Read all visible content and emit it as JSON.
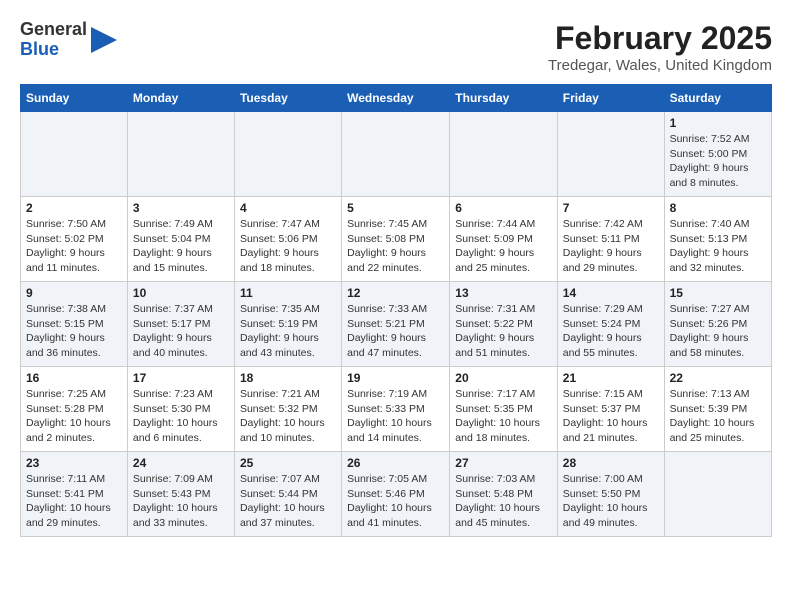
{
  "header": {
    "logo_general": "General",
    "logo_blue": "Blue",
    "month_year": "February 2025",
    "location": "Tredegar, Wales, United Kingdom"
  },
  "weekdays": [
    "Sunday",
    "Monday",
    "Tuesday",
    "Wednesday",
    "Thursday",
    "Friday",
    "Saturday"
  ],
  "weeks": [
    [
      {
        "day": "",
        "info": ""
      },
      {
        "day": "",
        "info": ""
      },
      {
        "day": "",
        "info": ""
      },
      {
        "day": "",
        "info": ""
      },
      {
        "day": "",
        "info": ""
      },
      {
        "day": "",
        "info": ""
      },
      {
        "day": "1",
        "info": "Sunrise: 7:52 AM\nSunset: 5:00 PM\nDaylight: 9 hours and 8 minutes."
      }
    ],
    [
      {
        "day": "2",
        "info": "Sunrise: 7:50 AM\nSunset: 5:02 PM\nDaylight: 9 hours and 11 minutes."
      },
      {
        "day": "3",
        "info": "Sunrise: 7:49 AM\nSunset: 5:04 PM\nDaylight: 9 hours and 15 minutes."
      },
      {
        "day": "4",
        "info": "Sunrise: 7:47 AM\nSunset: 5:06 PM\nDaylight: 9 hours and 18 minutes."
      },
      {
        "day": "5",
        "info": "Sunrise: 7:45 AM\nSunset: 5:08 PM\nDaylight: 9 hours and 22 minutes."
      },
      {
        "day": "6",
        "info": "Sunrise: 7:44 AM\nSunset: 5:09 PM\nDaylight: 9 hours and 25 minutes."
      },
      {
        "day": "7",
        "info": "Sunrise: 7:42 AM\nSunset: 5:11 PM\nDaylight: 9 hours and 29 minutes."
      },
      {
        "day": "8",
        "info": "Sunrise: 7:40 AM\nSunset: 5:13 PM\nDaylight: 9 hours and 32 minutes."
      }
    ],
    [
      {
        "day": "9",
        "info": "Sunrise: 7:38 AM\nSunset: 5:15 PM\nDaylight: 9 hours and 36 minutes."
      },
      {
        "day": "10",
        "info": "Sunrise: 7:37 AM\nSunset: 5:17 PM\nDaylight: 9 hours and 40 minutes."
      },
      {
        "day": "11",
        "info": "Sunrise: 7:35 AM\nSunset: 5:19 PM\nDaylight: 9 hours and 43 minutes."
      },
      {
        "day": "12",
        "info": "Sunrise: 7:33 AM\nSunset: 5:21 PM\nDaylight: 9 hours and 47 minutes."
      },
      {
        "day": "13",
        "info": "Sunrise: 7:31 AM\nSunset: 5:22 PM\nDaylight: 9 hours and 51 minutes."
      },
      {
        "day": "14",
        "info": "Sunrise: 7:29 AM\nSunset: 5:24 PM\nDaylight: 9 hours and 55 minutes."
      },
      {
        "day": "15",
        "info": "Sunrise: 7:27 AM\nSunset: 5:26 PM\nDaylight: 9 hours and 58 minutes."
      }
    ],
    [
      {
        "day": "16",
        "info": "Sunrise: 7:25 AM\nSunset: 5:28 PM\nDaylight: 10 hours and 2 minutes."
      },
      {
        "day": "17",
        "info": "Sunrise: 7:23 AM\nSunset: 5:30 PM\nDaylight: 10 hours and 6 minutes."
      },
      {
        "day": "18",
        "info": "Sunrise: 7:21 AM\nSunset: 5:32 PM\nDaylight: 10 hours and 10 minutes."
      },
      {
        "day": "19",
        "info": "Sunrise: 7:19 AM\nSunset: 5:33 PM\nDaylight: 10 hours and 14 minutes."
      },
      {
        "day": "20",
        "info": "Sunrise: 7:17 AM\nSunset: 5:35 PM\nDaylight: 10 hours and 18 minutes."
      },
      {
        "day": "21",
        "info": "Sunrise: 7:15 AM\nSunset: 5:37 PM\nDaylight: 10 hours and 21 minutes."
      },
      {
        "day": "22",
        "info": "Sunrise: 7:13 AM\nSunset: 5:39 PM\nDaylight: 10 hours and 25 minutes."
      }
    ],
    [
      {
        "day": "23",
        "info": "Sunrise: 7:11 AM\nSunset: 5:41 PM\nDaylight: 10 hours and 29 minutes."
      },
      {
        "day": "24",
        "info": "Sunrise: 7:09 AM\nSunset: 5:43 PM\nDaylight: 10 hours and 33 minutes."
      },
      {
        "day": "25",
        "info": "Sunrise: 7:07 AM\nSunset: 5:44 PM\nDaylight: 10 hours and 37 minutes."
      },
      {
        "day": "26",
        "info": "Sunrise: 7:05 AM\nSunset: 5:46 PM\nDaylight: 10 hours and 41 minutes."
      },
      {
        "day": "27",
        "info": "Sunrise: 7:03 AM\nSunset: 5:48 PM\nDaylight: 10 hours and 45 minutes."
      },
      {
        "day": "28",
        "info": "Sunrise: 7:00 AM\nSunset: 5:50 PM\nDaylight: 10 hours and 49 minutes."
      },
      {
        "day": "",
        "info": ""
      }
    ]
  ]
}
